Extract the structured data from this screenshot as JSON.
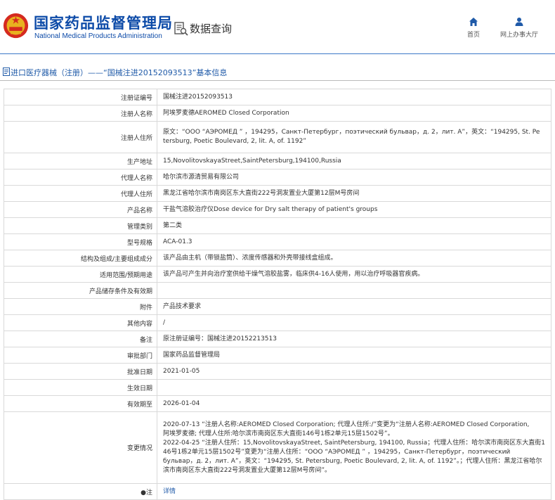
{
  "header": {
    "site_title": "国家药品监督管理局",
    "site_subtitle": "National Medical Products Administration",
    "query_title": "数据查询",
    "nav": {
      "home": "首页",
      "office": "网上办事大厅"
    }
  },
  "breadcrumb": "进口医疗器械（注册）——“国械注进20152093513”基本信息",
  "rows": [
    {
      "label": "注册证编号",
      "value": "国械注进20152093513"
    },
    {
      "label": "注册人名称",
      "value": "阿埃罗麦德AEROMED Closed Corporation"
    },
    {
      "label": "注册人住所",
      "lines": [
        "原文：“ООО  “АЭРОМЕД ” ，194295，Санкт-Петербург，поэтический бульвар，д. 2，лит. А”，英文：“194295, St. Pe",
        "tersburg, Poetic Boulevard, 2, lit. A, of. 1192”"
      ]
    },
    {
      "label": "生产地址",
      "value": "15,NovolitovskayaStreet,SaintPetersburg,194100,Russia"
    },
    {
      "label": "代理人名称",
      "value": "哈尔滨市源清贸易有限公司"
    },
    {
      "label": "代理人住所",
      "value": "黑龙江省哈尔滨市南岗区东大直街222号洞发置业大厦第12层M号房间"
    },
    {
      "label": "产品名称",
      "value": "干盐气溶胶治疗仪Dose device for Dry salt therapy of patient's groups"
    },
    {
      "label": "管理类别",
      "value": "第二类"
    },
    {
      "label": "型号规格",
      "value": "ACA-01.3"
    },
    {
      "label": "结构及组成/主要组成成分",
      "value": "该产品由主机（带锁盐筒）、浓度传感器和外壳带接线盒组成。"
    },
    {
      "label": "适用范围/预期用途",
      "value": "该产品可产生并向治疗室供给干燥气溶胶盐雾，临床供4-16人使用，用以治疗呼吸器官疾病。"
    },
    {
      "label": "产品储存条件及有效期",
      "value": ""
    },
    {
      "label": "附件",
      "value": "产品技术要求"
    },
    {
      "label": "其他内容",
      "value": "/"
    },
    {
      "label": "备注",
      "value": "原注册证编号：国械注进20152213513"
    },
    {
      "label": "审批部门",
      "value": "国家药品监督管理局"
    },
    {
      "label": "批准日期",
      "value": "2021-01-05"
    },
    {
      "label": "生效日期",
      "value": ""
    },
    {
      "label": "有效期至",
      "value": "2026-01-04"
    },
    {
      "label": "变更情况",
      "lines": [
        "2020-07-13 “注册人名称:AEROMED Closed Corporation; 代理人住所:/”变更为“注册人名称:AEROMED Closed Corporation,",
        "阿埃罗麦德; 代理人住所:哈尔滨市南岗区东大直街146号1栋2单元15层1502号”。",
        "2022-04-25 “注册人住所：15,NovolitovskayaStreet, SaintPetersburg, 194100, Russia；代理人住所：哈尔滨市南岗区东大直街1",
        "46号1栋2单元15层1502号”变更为“注册人住所：“ООО  “АЭРОМЕД ” ，194295，Санкт-Петербург，поэтический",
        "бульвар，д. 2，лит. А”，英文：“194295, St. Petersburg, Poetic Boulevard, 2, lit. A, of. 1192”。；代理人住所：黑龙江省哈尔",
        "滨市南岗区东大直街222号洞发置业大厦第12层M号房间”。"
      ]
    },
    {
      "label": "●注",
      "link": "详情"
    }
  ]
}
